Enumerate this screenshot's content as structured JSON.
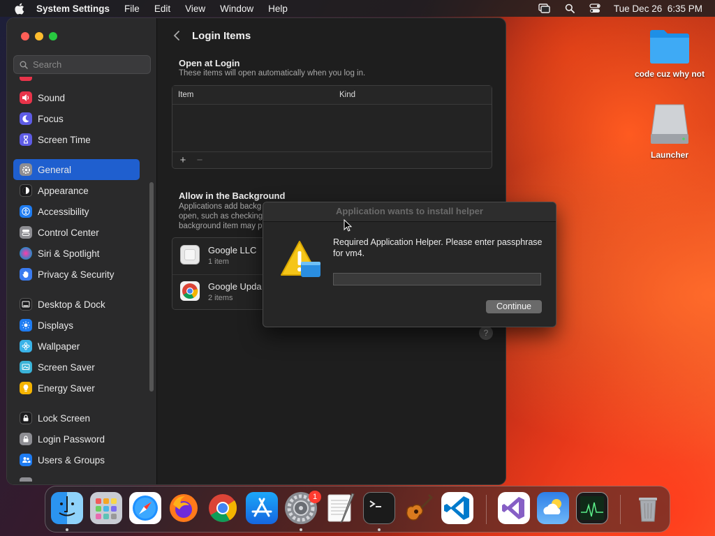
{
  "menubar": {
    "app_name": "System Settings",
    "menus": [
      "File",
      "Edit",
      "View",
      "Window",
      "Help"
    ],
    "datetime": "Tue Dec 26  6:35 PM"
  },
  "sidebar": {
    "search_placeholder": "Search",
    "items": [
      {
        "label": "Sound",
        "icon": "speaker-icon",
        "color": "#e8344a"
      },
      {
        "label": "Focus",
        "icon": "moon-icon",
        "color": "#5e5ce6"
      },
      {
        "label": "Screen Time",
        "icon": "hourglass-icon",
        "color": "#5e5ce6"
      },
      {
        "label": "General",
        "icon": "gear-icon",
        "color": "#8e8e93",
        "selected": true
      },
      {
        "label": "Appearance",
        "icon": "appearance-icon",
        "color": "#1c1c1e"
      },
      {
        "label": "Accessibility",
        "icon": "accessibility-icon",
        "color": "#1e7cf2"
      },
      {
        "label": "Control Center",
        "icon": "toggles-icon",
        "color": "#8e8e93"
      },
      {
        "label": "Siri & Spotlight",
        "icon": "siri-icon",
        "color": "#b04ad8"
      },
      {
        "label": "Privacy & Security",
        "icon": "hand-icon",
        "color": "#3a7bf0"
      },
      {
        "label": "Desktop & Dock",
        "icon": "dock-icon",
        "color": "#1c1c1e"
      },
      {
        "label": "Displays",
        "icon": "sun-icon",
        "color": "#1e7cf2"
      },
      {
        "label": "Wallpaper",
        "icon": "flower-icon",
        "color": "#3ab3e8"
      },
      {
        "label": "Screen Saver",
        "icon": "screensaver-icon",
        "color": "#3ab3d8"
      },
      {
        "label": "Energy Saver",
        "icon": "bulb-icon",
        "color": "#f5b400"
      },
      {
        "label": "Lock Screen",
        "icon": "lock-icon",
        "color": "#1c1c1e"
      },
      {
        "label": "Login Password",
        "icon": "padlock-icon",
        "color": "#8e8e93"
      },
      {
        "label": "Users & Groups",
        "icon": "users-icon",
        "color": "#1e7cf2"
      }
    ]
  },
  "main": {
    "title": "Login Items",
    "open_at_login": {
      "title": "Open at Login",
      "subtitle": "These items will open automatically when you log in.",
      "col_item": "Item",
      "col_kind": "Kind",
      "add": "+",
      "remove": "−"
    },
    "background": {
      "title": "Allow in the Background",
      "subtitle_lines": [
        "Applications add backg",
        "open, such as checking",
        "background item may p"
      ],
      "items": [
        {
          "name": "Google LLC",
          "count": "1 item"
        },
        {
          "name": "Google Upda",
          "count": "2 items"
        }
      ]
    },
    "help": "?"
  },
  "dialog": {
    "title": "Application wants to install helper",
    "message": "Required Application Helper. Please enter passphrase for vm4.",
    "password_value": "",
    "continue_label": "Continue"
  },
  "desktop": {
    "icons": [
      {
        "label": "code cuz why not",
        "icon": "folder-icon"
      },
      {
        "label": "Launcher",
        "icon": "drive-icon"
      }
    ]
  },
  "dock": {
    "settings_badge": "1",
    "apps": [
      "Finder",
      "Launchpad",
      "Safari",
      "Firefox",
      "Chrome",
      "App Store",
      "System Settings",
      "TextEdit",
      "Terminal",
      "GarageBand",
      "Visual Studio Code",
      "Visual Studio",
      "Weather",
      "Activity Monitor",
      "Trash"
    ]
  }
}
